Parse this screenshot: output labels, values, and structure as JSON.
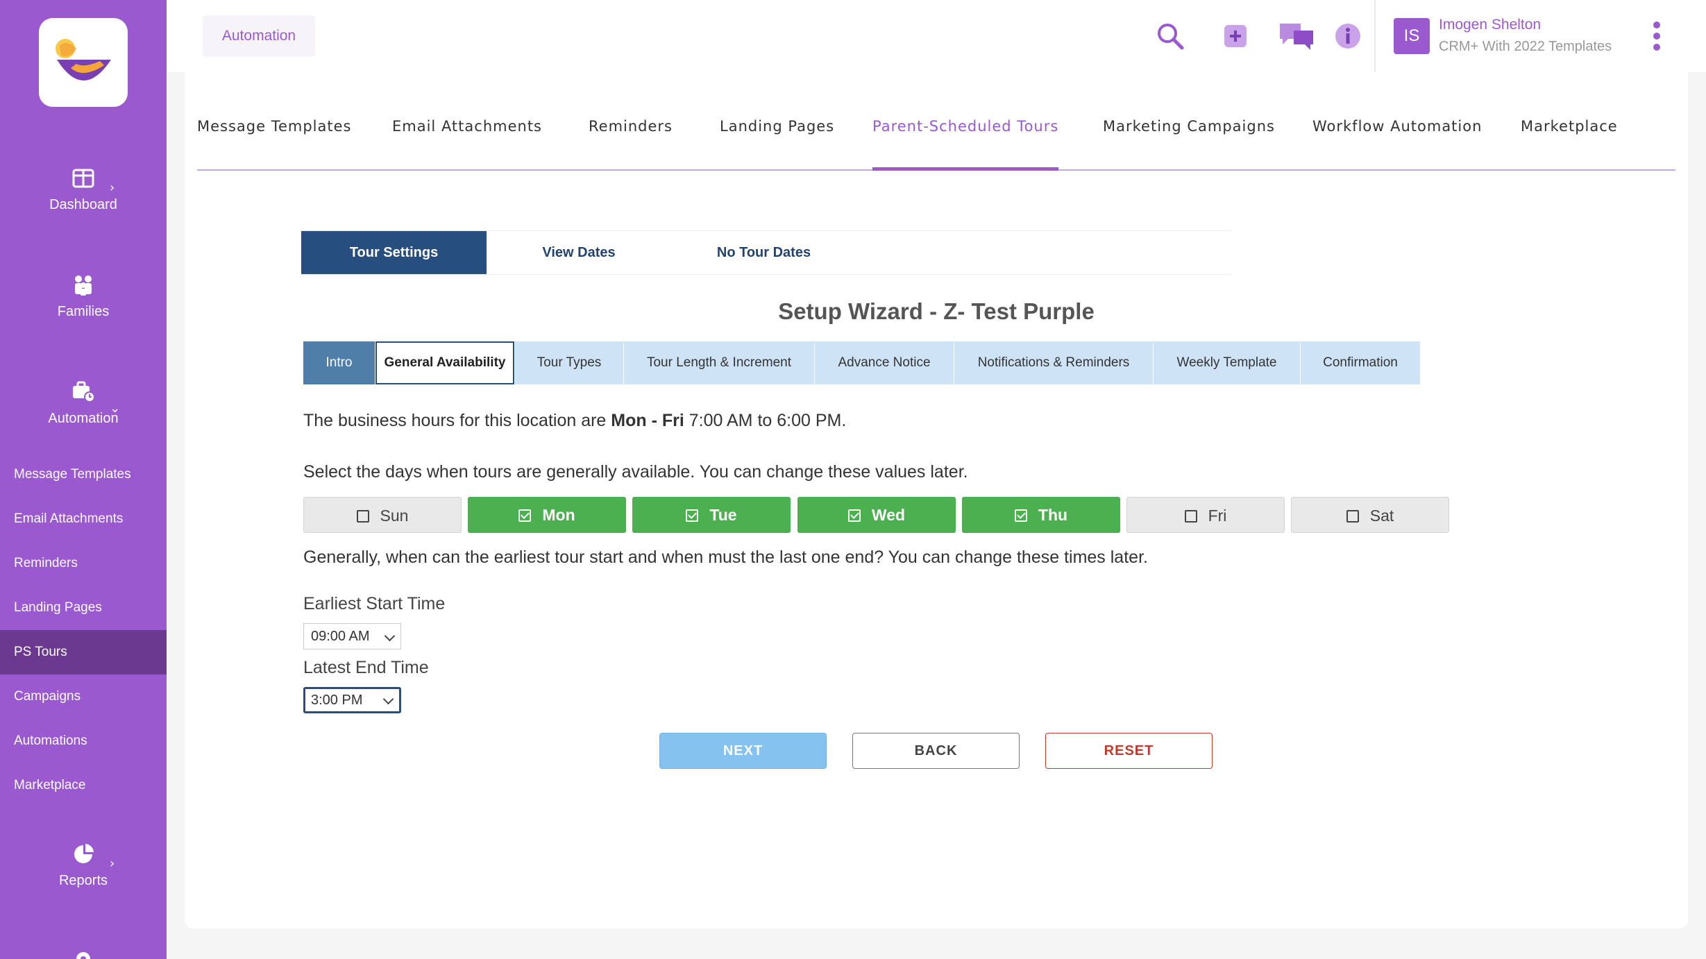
{
  "sidebar": {
    "main": [
      {
        "label": "Dashboard",
        "icon": "dashboard-icon",
        "chevron": "›"
      },
      {
        "label": "Families",
        "icon": "families-icon",
        "chevron": ""
      },
      {
        "label": "Automation",
        "icon": "automation-icon",
        "chevron": "⌄"
      }
    ],
    "sub_items": [
      {
        "label": "Message Templates"
      },
      {
        "label": "Email Attachments"
      },
      {
        "label": "Reminders"
      },
      {
        "label": "Landing Pages"
      },
      {
        "label": "PS Tours",
        "active": true
      },
      {
        "label": "Campaigns"
      },
      {
        "label": "Automations"
      },
      {
        "label": "Marketplace"
      }
    ],
    "reports": {
      "label": "Reports",
      "icon": "reports-icon",
      "chevron": "›"
    }
  },
  "topbar": {
    "breadcrumb": "Automation",
    "icons": [
      "search-icon",
      "add-icon",
      "chat-icon",
      "info-icon"
    ],
    "user": {
      "initials": "IS",
      "name": "Imogen Shelton",
      "org": "CRM+ With 2022 Templates"
    }
  },
  "top_tabs": [
    {
      "label": "Message Templates"
    },
    {
      "label": "Email Attachments"
    },
    {
      "label": "Reminders"
    },
    {
      "label": "Landing Pages"
    },
    {
      "label": "Parent-Scheduled Tours",
      "active": true
    },
    {
      "label": "Marketing Campaigns"
    },
    {
      "label": "Workflow Automation"
    },
    {
      "label": "Marketplace"
    }
  ],
  "settings_tabs": [
    {
      "label": "Tour Settings",
      "active": true
    },
    {
      "label": "View Dates"
    },
    {
      "label": "No Tour Dates"
    }
  ],
  "wizard": {
    "title": "Setup Wizard - Z- Test Purple",
    "steps": [
      {
        "label": "Intro",
        "state": "done"
      },
      {
        "label": "General Availability",
        "state": "current"
      },
      {
        "label": "Tour Types"
      },
      {
        "label": "Tour Length & Increment"
      },
      {
        "label": "Advance Notice"
      },
      {
        "label": "Notifications & Reminders"
      },
      {
        "label": "Weekly Template"
      },
      {
        "label": "Confirmation"
      }
    ],
    "hours_prefix": "The business hours for this location are ",
    "hours_days": "Mon - Fri",
    "hours_time": " 7:00 AM to 6:00 PM.",
    "select_days_text": "Select the days when tours are generally available. You can change these values later.",
    "days": [
      {
        "label": "Sun",
        "checked": false
      },
      {
        "label": "Mon",
        "checked": true
      },
      {
        "label": "Tue",
        "checked": true
      },
      {
        "label": "Wed",
        "checked": true
      },
      {
        "label": "Thu",
        "checked": true
      },
      {
        "label": "Fri",
        "checked": false
      },
      {
        "label": "Sat",
        "checked": false
      }
    ],
    "times_text": "Generally, when can the earliest tour start and when must the last one end? You can change these times later.",
    "earliest_label": "Earliest Start Time",
    "earliest_value": "09:00 AM",
    "latest_label": "Latest End Time",
    "latest_value": "3:00 PM",
    "buttons": {
      "next": "NEXT",
      "back": "BACK",
      "reset": "RESET"
    }
  },
  "colors": {
    "sidebar": "#9b59d0",
    "sidebar_active": "#6b3a90",
    "accent": "#9b59d0",
    "navy": "#264e7e",
    "step_bg": "#cfe3f7",
    "day_on": "#4caf50",
    "next_btn": "#85c3ee",
    "reset": "#c0392b"
  }
}
